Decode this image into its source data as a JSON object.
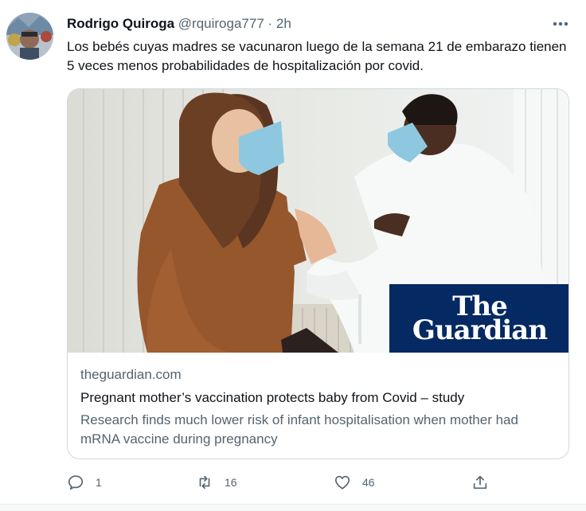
{
  "tweet": {
    "author_name": "Rodrigo Quiroga",
    "author_handle": "@rquiroga777",
    "separator": "·",
    "timestamp": "2h",
    "text": "Los bebés cuyas madres se vacunaron luego de la semana 21 de embarazo tienen 5 veces menos probabilidades de hospitalización por covid."
  },
  "card": {
    "logo_line1": "The",
    "logo_line2": "Guardian",
    "domain": "theguardian.com",
    "title": "Pregnant mother’s vaccination protects baby from Covid – study",
    "description": "Research finds much lower risk of infant hospitalisation when mother had mRNA vaccine during pregnancy"
  },
  "actions": {
    "reply_count": "1",
    "retweet_count": "16",
    "like_count": "46"
  },
  "icons": {
    "more": "more-horizontal-icon",
    "reply": "reply-icon",
    "retweet": "retweet-icon",
    "like": "heart-icon",
    "share": "share-icon"
  },
  "colors": {
    "brand_navy": "#052962",
    "text_primary": "#0f1419",
    "text_secondary": "#536471"
  }
}
